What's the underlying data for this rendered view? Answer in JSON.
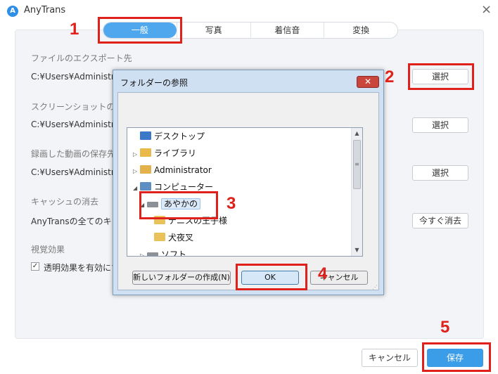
{
  "app": {
    "title": "AnyTrans",
    "close": "×"
  },
  "tabs": [
    {
      "label": "一般",
      "active": true
    },
    {
      "label": "写真",
      "active": false
    },
    {
      "label": "着信音",
      "active": false
    },
    {
      "label": "変換",
      "active": false
    }
  ],
  "settings": {
    "export": {
      "label": "ファイルのエクスポート先",
      "path": "C:¥Users¥Administrator",
      "button": "選択"
    },
    "screenshot": {
      "label": "スクリーンショットの保存先",
      "path": "C:¥Users¥Administrator",
      "button": "選択"
    },
    "recording": {
      "label": "録画した動画の保存先",
      "path": "C:¥Users¥Administrator",
      "button": "選択"
    },
    "cache": {
      "label": "キャッシュの消去",
      "text": "AnyTransの全てのキャッシュを消去",
      "button": "今すぐ消去"
    },
    "visual": {
      "label": "視覚効果",
      "checkbox_label": "透明効果を有効にする",
      "checked": true
    }
  },
  "dialog": {
    "title": "フォルダーの参照",
    "close": "✕",
    "tree": [
      {
        "label": "デスクトップ",
        "icon": "desktop-icon"
      },
      {
        "label": "ライブラリ",
        "icon": "library-icon"
      },
      {
        "label": "Administrator",
        "icon": "user-folder-icon"
      },
      {
        "label": "コンピューター",
        "icon": "computer-icon"
      },
      {
        "label": "あやかの",
        "icon": "drive-icon",
        "selected": true
      },
      {
        "label": "テニスの王子様",
        "icon": "folder-icon"
      },
      {
        "label": "犬夜叉",
        "icon": "folder-icon"
      },
      {
        "label": "ソフト",
        "icon": "drive-icon"
      }
    ],
    "new_folder_button": "新しいフォルダーの作成(N)",
    "ok_button": "OK",
    "cancel_button": "キャンセル"
  },
  "footer": {
    "cancel": "キャンセル",
    "save": "保存"
  },
  "annotations": [
    "1",
    "2",
    "3",
    "4",
    "5"
  ],
  "colors": {
    "highlight": "#e0201b",
    "accent": "#3b9ce8"
  }
}
